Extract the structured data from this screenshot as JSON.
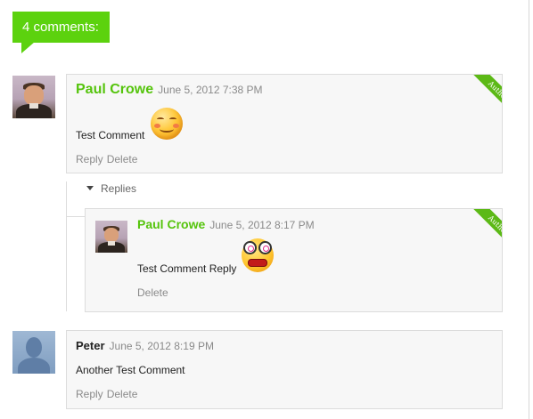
{
  "comments_header": {
    "count_label": "4 comments:"
  },
  "comments": [
    {
      "author": "Paul Crowe",
      "date": "June 5, 2012 7:38 PM",
      "text": "Test Comment",
      "emoticon": "smiling-emoticon",
      "badge": "Author",
      "actions": [
        "Reply",
        "Delete"
      ]
    },
    {
      "author": "Peter",
      "date": "June 5, 2012 8:19 PM",
      "text": "Another Test Comment",
      "actions": [
        "Reply",
        "Delete"
      ]
    }
  ],
  "replies_toggle": {
    "label": "Replies",
    "icon": "triangle-down-icon"
  },
  "replies": [
    {
      "author": "Paul Crowe",
      "date": "June 5, 2012 8:17 PM",
      "text": "Test Comment Reply",
      "emoticon": "crazy-emoticon",
      "badge": "Author",
      "actions": [
        "Delete"
      ]
    }
  ],
  "colors": {
    "accent": "#5cd20e",
    "name_green": "#55c40c",
    "card_bg": "#f7f7f7",
    "muted": "#8a8a8a"
  }
}
